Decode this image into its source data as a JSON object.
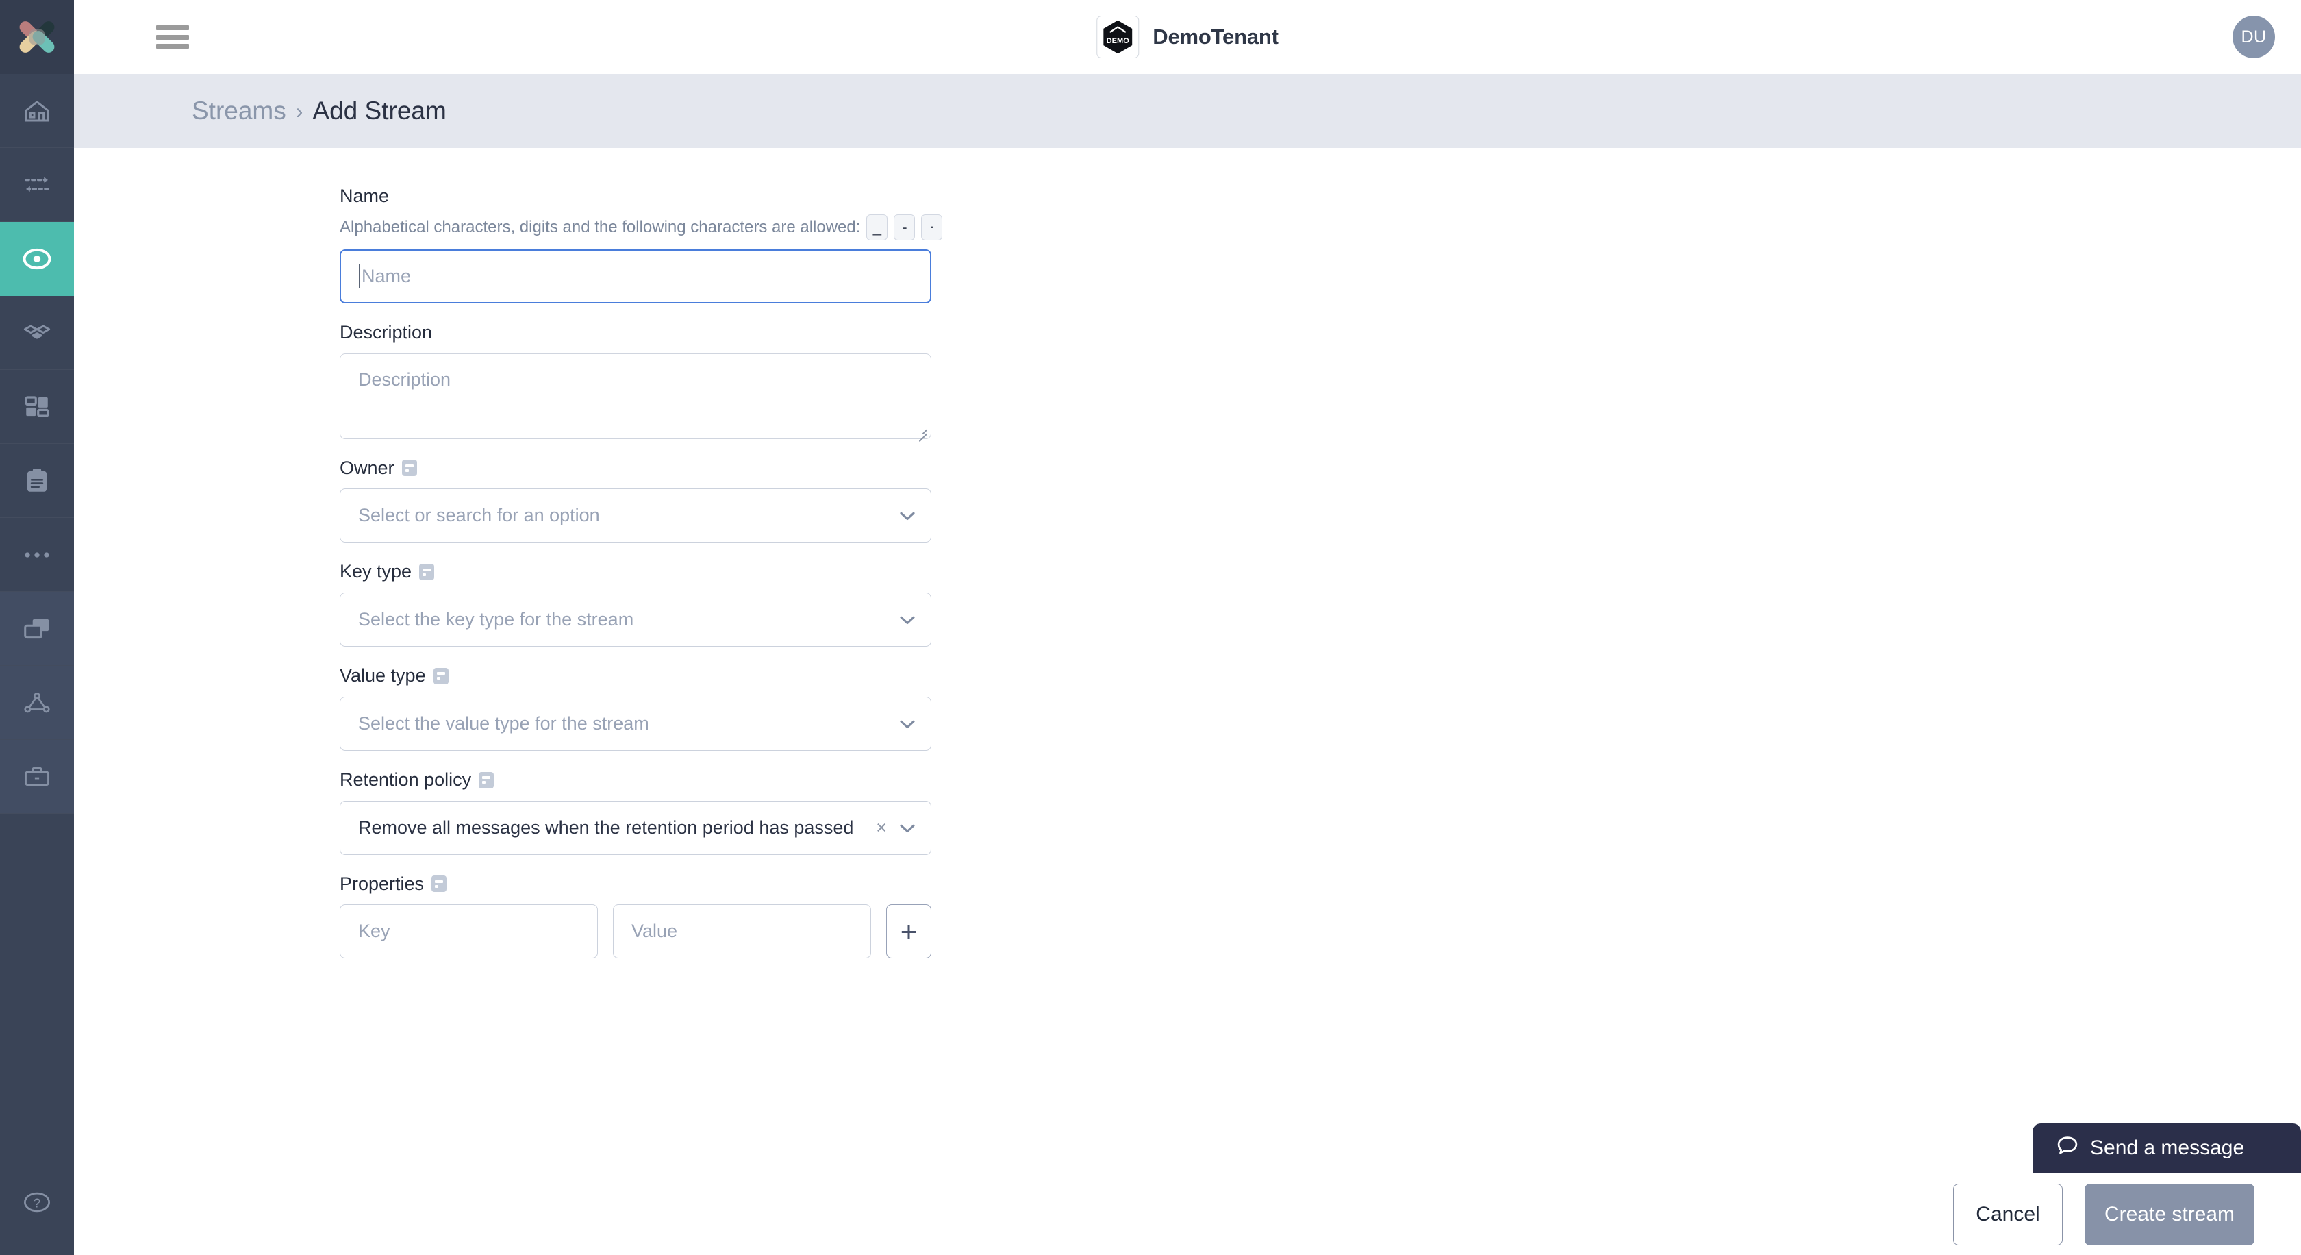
{
  "app": {
    "logo_icon": "app-logo-x-icon"
  },
  "sidebar": {
    "items": [
      {
        "icon": "home-icon",
        "name": "sidebar-item-home",
        "active": false
      },
      {
        "icon": "data-flow-icon",
        "name": "sidebar-item-connectors",
        "active": false
      },
      {
        "icon": "record-dot-icon",
        "name": "sidebar-item-streams",
        "active": true
      },
      {
        "icon": "topology-icon",
        "name": "sidebar-item-topology",
        "active": false
      },
      {
        "icon": "grid-tiles-icon",
        "name": "sidebar-item-dashboards",
        "active": false
      },
      {
        "icon": "clipboard-icon",
        "name": "sidebar-item-reports",
        "active": false
      },
      {
        "icon": "ellipsis-icon",
        "name": "sidebar-item-more",
        "active": false
      },
      {
        "icon": "copy-windows-icon",
        "name": "sidebar-item-instances",
        "active": false
      },
      {
        "icon": "triangle-nodes-icon",
        "name": "sidebar-item-network",
        "active": false
      },
      {
        "icon": "briefcase-icon",
        "name": "sidebar-item-workspace",
        "active": false
      }
    ],
    "help_icon": "help-circle-icon",
    "active_color": "#4dbcae",
    "bg_color": "#3a4457"
  },
  "topbar": {
    "menu_icon": "hamburger-menu-icon",
    "tenant_logo_text": "DEMO",
    "tenant_name": "DemoTenant",
    "avatar_initials": "DU"
  },
  "breadcrumb": {
    "parent": "Streams",
    "separator": "›",
    "current": "Add Stream"
  },
  "form": {
    "name": {
      "label": "Name",
      "hint": "Alphabetical characters, digits and the following characters are allowed:",
      "allowed_chars": [
        "_",
        "-",
        "."
      ],
      "placeholder": "Name",
      "value": "",
      "focused": true
    },
    "description": {
      "label": "Description",
      "placeholder": "Description",
      "value": ""
    },
    "owner": {
      "label": "Owner",
      "placeholder": "Select or search for an option",
      "value": "",
      "tooltip_icon": "info-tooltip-icon"
    },
    "key_type": {
      "label": "Key type",
      "placeholder": "Select the key type for the stream",
      "value": "",
      "tooltip_icon": "info-tooltip-icon"
    },
    "value_type": {
      "label": "Value type",
      "placeholder": "Select the value type for the stream",
      "value": "",
      "tooltip_icon": "info-tooltip-icon"
    },
    "retention_policy": {
      "label": "Retention policy",
      "value": "Remove all messages when the retention period has passed",
      "clear_label": "×",
      "tooltip_icon": "info-tooltip-icon"
    },
    "properties": {
      "label": "Properties",
      "key_placeholder": "Key",
      "key_value": "",
      "value_placeholder": "Value",
      "value_value": "",
      "add_label": "+",
      "tooltip_icon": "info-tooltip-icon"
    }
  },
  "footer": {
    "cancel_label": "Cancel",
    "create_label": "Create stream"
  },
  "chat": {
    "label": "Send a message",
    "icon": "chat-bubble-icon"
  }
}
